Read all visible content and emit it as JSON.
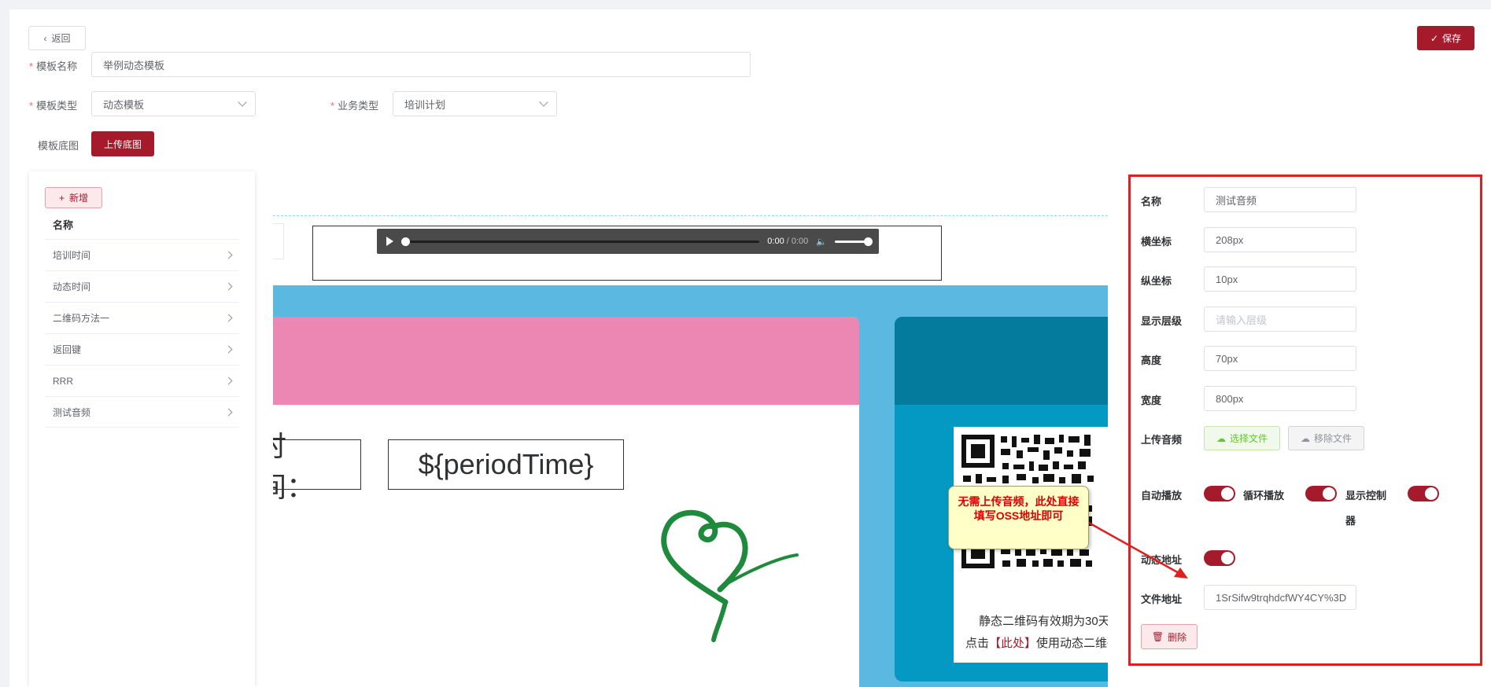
{
  "header": {
    "back_label": "返回",
    "save_label": "保存"
  },
  "form": {
    "template_name_label": "模板名称",
    "template_name_value": "举例动态模板",
    "template_type_label": "模板类型",
    "template_type_value": "动态模板",
    "business_type_label": "业务类型",
    "business_type_value": "培训计划",
    "template_bg_label": "模板底图",
    "upload_bg_label": "上传底图"
  },
  "left_panel": {
    "add_label": "新增",
    "list_header": "名称",
    "items": [
      "培训时间",
      "动态时间",
      "二维码方法一",
      "返回键",
      "RRR",
      "测试音频"
    ]
  },
  "canvas": {
    "audio_time": "0:00",
    "audio_duration": "/ 0:00",
    "period_label": "时间：",
    "period_value": "${periodTime}",
    "qr_text1": "静态二维码有效期为30天",
    "qr_text2_prefix": "点击",
    "qr_text2_link": "【此处】",
    "qr_text2_suffix": "使用动态二维码"
  },
  "annotation": {
    "tooltip_text": "无需上传音频，此处直接填写OSS地址即可",
    "accent_color": "#e01f1f"
  },
  "right_panel": {
    "name_label": "名称",
    "name_value": "测试音频",
    "x_label": "横坐标",
    "x_value": "208px",
    "y_label": "纵坐标",
    "y_value": "10px",
    "zindex_label": "显示层级",
    "zindex_placeholder": "请输入层级",
    "height_label": "高度",
    "height_value": "70px",
    "width_label": "宽度",
    "width_value": "800px",
    "upload_audio_label": "上传音频",
    "choose_file_label": "选择文件",
    "remove_file_label": "移除文件",
    "autoplay_label": "自动播放",
    "autoplay_on": true,
    "loop_label": "循环播放",
    "loop_on": true,
    "controls_label_1": "显示控制",
    "controls_label_2": "器",
    "controls_on": true,
    "dynamic_addr_label": "动态地址",
    "dynamic_addr_on": true,
    "file_addr_label": "文件地址",
    "file_addr_value": "1SrSifw9trqhdcfWY4CY%3D",
    "delete_label": "删除"
  },
  "colors": {
    "brand": "#a61b2b",
    "pink": "#ec87b4",
    "sky": "#5bb8e0",
    "teal": "#0399c2"
  }
}
